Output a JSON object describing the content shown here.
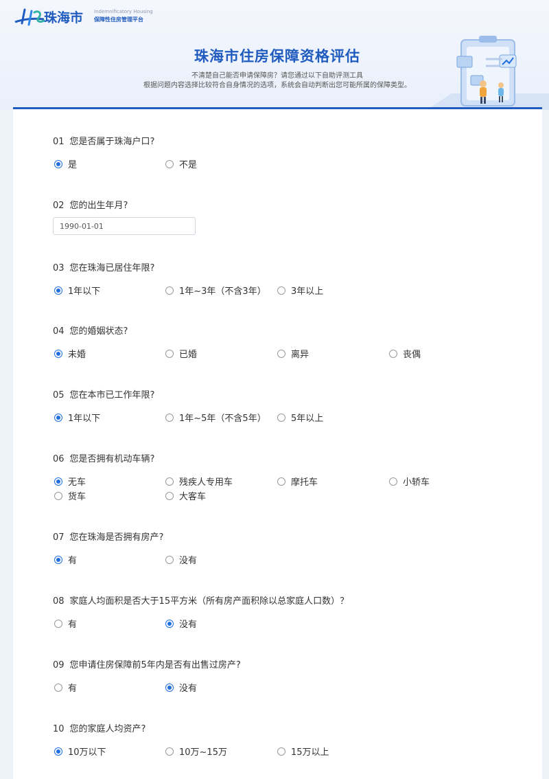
{
  "header": {
    "logo_text": "珠海市",
    "logo_en": "Indemnificatory Housing",
    "logo_cn": "保障性住房管理平台",
    "title": "珠海市住房保障资格评估",
    "subtitle_1": "不清楚自己能否申请保障房？请您通过以下自助评测工具",
    "subtitle_2": "根据问题内容选择比较符合自身情况的选项，系统会自动判断出您可能所属的保障类型。"
  },
  "colors": {
    "brand": "#1f5bbf",
    "radio_active": "#1f6fe0"
  },
  "questions": [
    {
      "num": "01",
      "text": "您是否属于珠海户口?",
      "options": [
        "是",
        "不是"
      ],
      "selected": 0
    },
    {
      "num": "02",
      "text": "您的出生年月?",
      "input_value": "1990-01-01"
    },
    {
      "num": "03",
      "text": "您在珠海已居住年限?",
      "options": [
        "1年以下",
        "1年~3年（不含3年）",
        "3年以上"
      ],
      "selected": 0
    },
    {
      "num": "04",
      "text": "您的婚姻状态?",
      "options": [
        "未婚",
        "已婚",
        "离异",
        "丧偶"
      ],
      "selected": 0
    },
    {
      "num": "05",
      "text": "您在本市已工作年限?",
      "options": [
        "1年以下",
        "1年~5年（不含5年）",
        "5年以上"
      ],
      "selected": 0
    },
    {
      "num": "06",
      "text": "您是否拥有机动车辆?",
      "options": [
        "无车",
        "残疾人专用车",
        "摩托车",
        "小轿车",
        "货车",
        "大客车"
      ],
      "selected": 0
    },
    {
      "num": "07",
      "text": "您在珠海是否拥有房产?",
      "options": [
        "有",
        "没有"
      ],
      "selected": 0
    },
    {
      "num": "08",
      "text": "家庭人均面积是否大于15平方米（所有房产面积除以总家庭人口数）？",
      "options": [
        "有",
        "没有"
      ],
      "selected": 1
    },
    {
      "num": "09",
      "text": "您申请住房保障前5年内是否有出售过房产?",
      "options": [
        "有",
        "没有"
      ],
      "selected": 1
    },
    {
      "num": "10",
      "text": "您的家庭人均资产?",
      "options": [
        "10万以下",
        "10万~15万",
        "15万以上"
      ],
      "selected": 0
    }
  ]
}
